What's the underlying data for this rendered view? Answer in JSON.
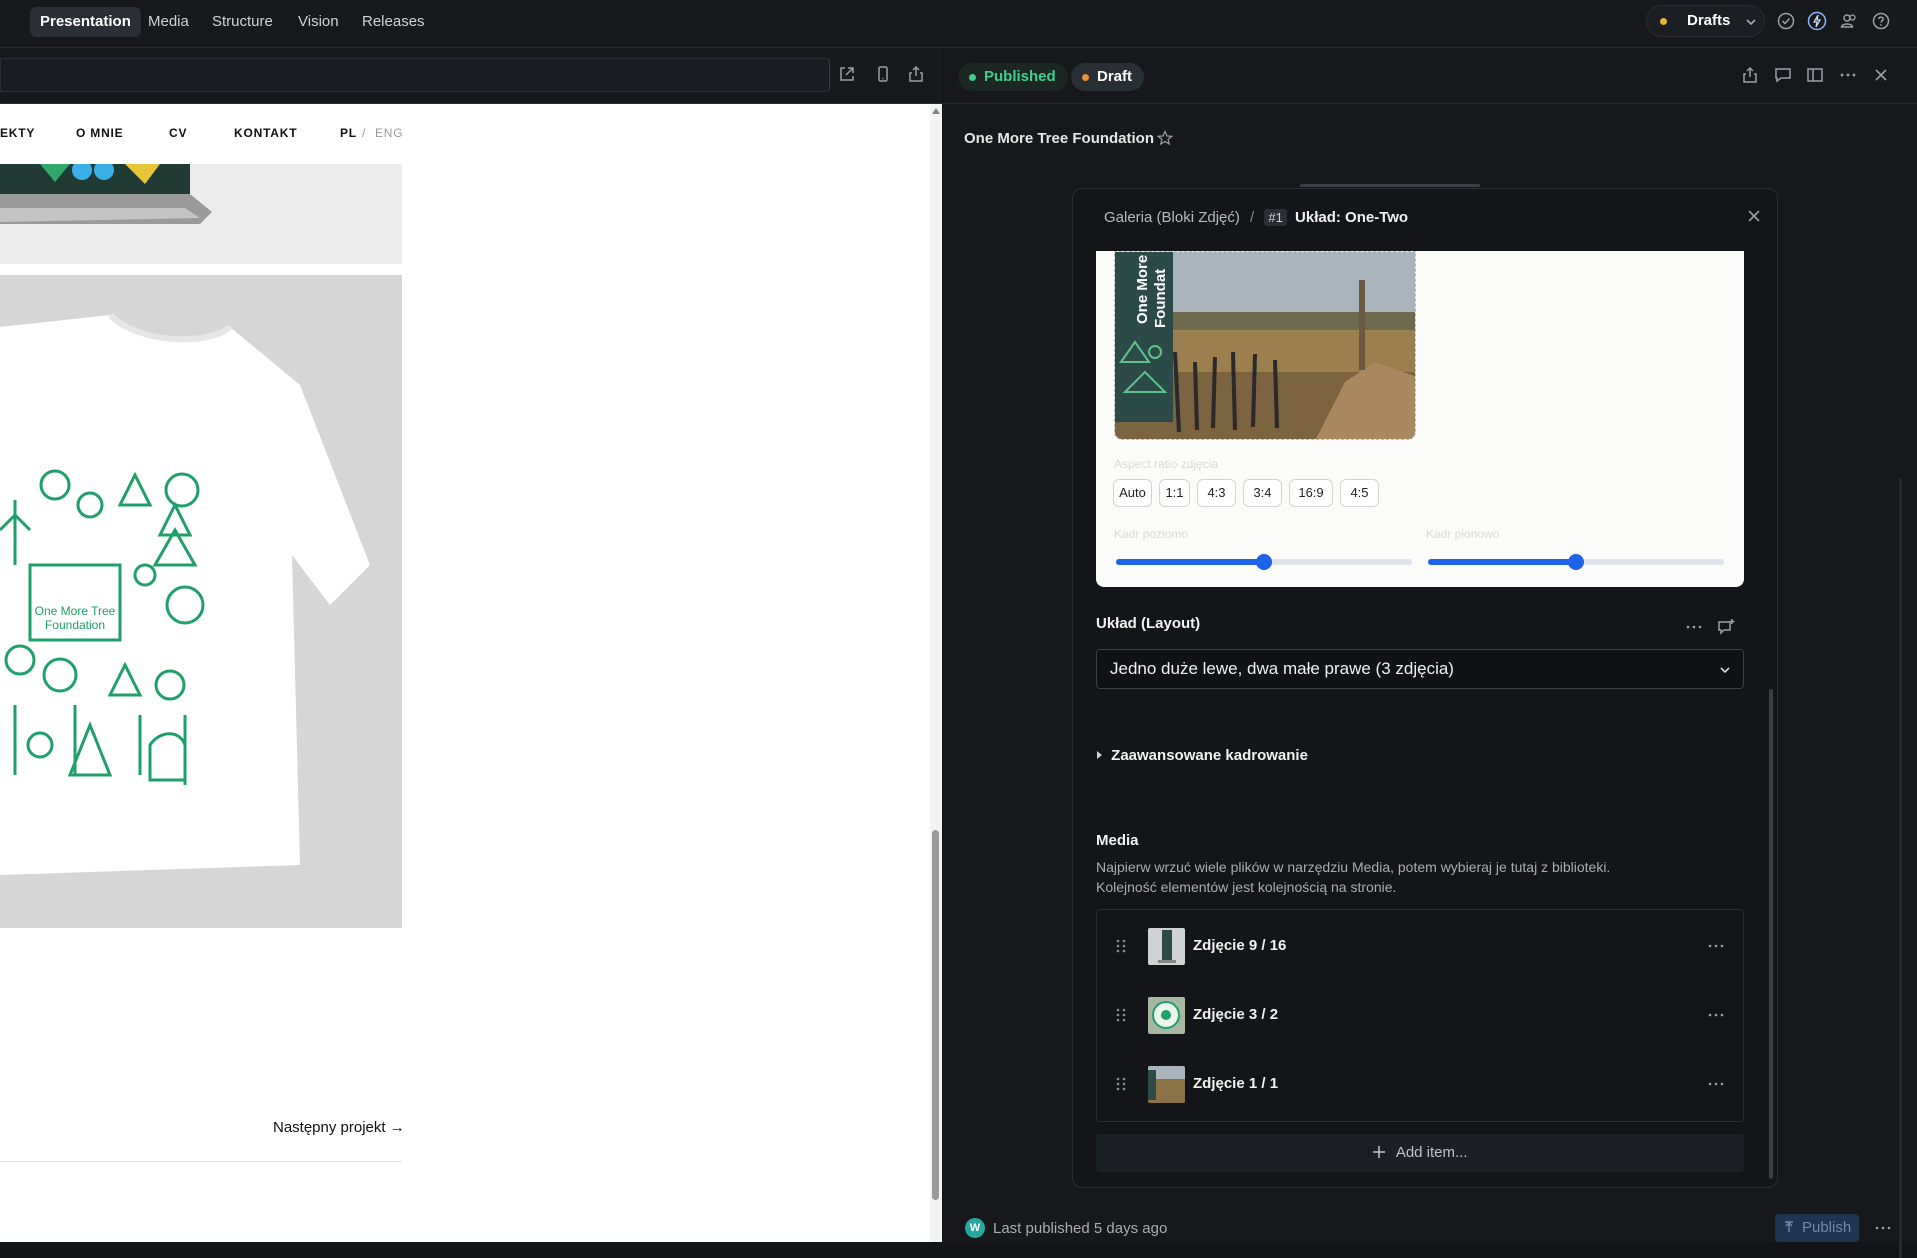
{
  "topbar": {
    "tabs": [
      "Presentation",
      "Media",
      "Structure",
      "Vision",
      "Releases"
    ],
    "drafts_label": "Drafts",
    "drafts_dot_color": "#e8b33c",
    "icons": [
      "check-circle-icon",
      "lightning-icon",
      "users-icon",
      "help-icon"
    ]
  },
  "preview": {
    "url_icons": [
      "external-link-icon",
      "mobile-icon",
      "share-icon"
    ],
    "nav": [
      "EKTY",
      "O MNIE",
      "CV",
      "KONTAKT"
    ],
    "lang_pl": "PL",
    "lang_sep": "/",
    "lang_eng": "ENG",
    "tshirt_logo_line1": "One More Tree",
    "tshirt_logo_line2": "Foundation",
    "next_project": "Następny projekt →"
  },
  "panel": {
    "status_published": "Published",
    "status_draft": "Draft",
    "published_color": "#3ecf8e",
    "draft_color": "#e8923c",
    "document_title": "One More Tree Foundation",
    "header_icons": [
      "share-icon",
      "comment-icon",
      "split-view-icon",
      "more-icon",
      "close-icon"
    ],
    "modal": {
      "breadcrumb_parent": "Galeria (Bloki Zdjęć)",
      "breadcrumb_sep": "/",
      "breadcrumb_index": "#1",
      "breadcrumb_title": "Układ: One-Two",
      "photo_caption_line1": "One More",
      "photo_caption_line2": "Foundat",
      "aspect_label": "Aspect ratio zdjęcia",
      "aspect_options": [
        "Auto",
        "1:1",
        "4:3",
        "3:4",
        "16:9",
        "4:5"
      ],
      "slider_h_label": "Kadr poziomo",
      "slider_v_label": "Kadr pionowo",
      "slider_h_value": 0.5,
      "slider_v_value": 0.5,
      "layout_label": "Układ (Layout)",
      "layout_value": "Jedno duże lewe, dwa małe prawe (3 zdjęcia)",
      "advanced_label": "Zaawansowane kadrowanie",
      "media_label": "Media",
      "media_help": "Najpierw wrzuć wiele plików w narzędziu Media, potem wybieraj je tutaj z biblioteki. Kolejność elementów jest kolejnością na stronie.",
      "media_items": [
        "Zdjęcie 9 / 16",
        "Zdjęcie 3 / 2",
        "Zdjęcie 1 / 1"
      ],
      "add_item": "Add item..."
    },
    "footer": {
      "avatar_letter": "W",
      "last_published": "Last published 5 days ago",
      "publish_button": "Publish"
    }
  }
}
